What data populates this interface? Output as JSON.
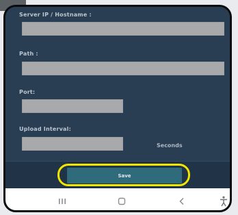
{
  "form": {
    "server_label": "Server IP / Hostname :",
    "server_value": "",
    "path_label": "Path :",
    "path_value": "",
    "port_label": "Port:",
    "port_value": "",
    "interval_label": "Upload Interval:",
    "interval_value": "",
    "interval_unit": "Seconds"
  },
  "actions": {
    "save_label": "Save",
    "highlight_color": "#f2e600"
  },
  "nav": {
    "recents_icon": "recents-icon",
    "home_icon": "home-icon",
    "back_icon": "back-icon",
    "accessibility_icon": "accessibility-icon"
  },
  "theme": {
    "background": "#2a3e53",
    "input_fill": "#a7a9ab",
    "button_fill": "#2f6b7b"
  }
}
